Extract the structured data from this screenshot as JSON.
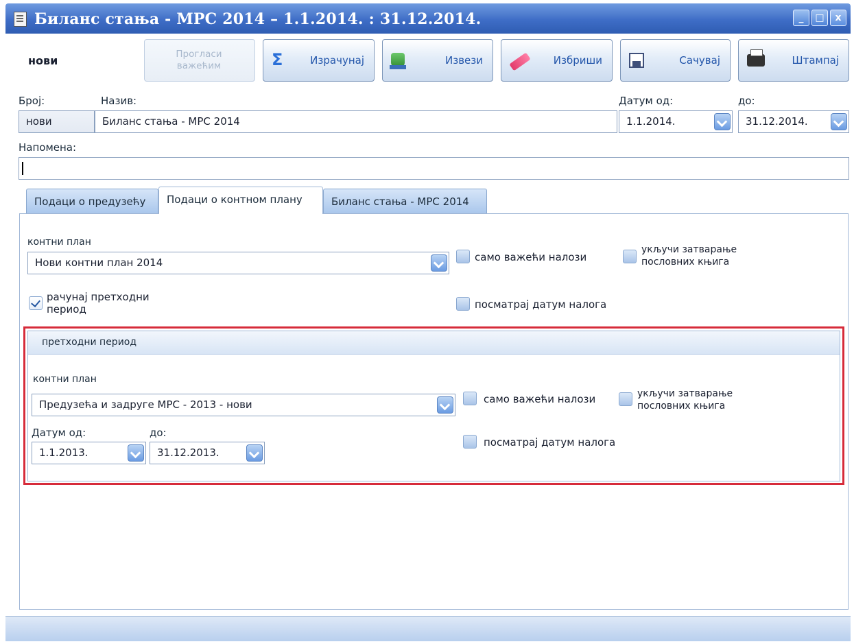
{
  "window": {
    "title": "Биланс стања - МРС 2014 – 1.1.2014. : 31.12.2014.",
    "buttons": {
      "minimize": "_",
      "maximize": "□",
      "close": "x"
    }
  },
  "toolbar": {
    "status": "нови",
    "declare_valid": "Прогласи важећим",
    "calculate": "Израчунај",
    "export": "Извези",
    "delete": "Избриши",
    "save": "Сачувај",
    "print": "Штампај"
  },
  "form": {
    "number_label": "Број:",
    "number_value": "нови",
    "name_label": "Назив:",
    "name_value": "Биланс стања - МРС 2014",
    "date_from_label": "Датум од:",
    "date_from_value": "1.1.2014.",
    "date_to_label": "до:",
    "date_to_value": "31.12.2014.",
    "note_label": "Напомена:",
    "note_value": ""
  },
  "tabs": [
    {
      "label": "Подаци о предузећу"
    },
    {
      "label": "Подаци о контном плану"
    },
    {
      "label": "Биланс стања - МРС 2014"
    }
  ],
  "current": {
    "plan_label": "контни план",
    "plan_value": "Нови контни план 2014",
    "only_valid": "само важећи налози",
    "include_closing_line1": "укључи затварање",
    "include_closing_line2": "пословних књига",
    "calc_prev_line1": "рачунај претходни",
    "calc_prev_line2": "период",
    "observe_date": "посматрај датум налога"
  },
  "previous": {
    "group_title": "претходни период",
    "plan_label": "контни план",
    "plan_value": "Предузећа и задруге МРС - 2013 - нови",
    "date_from_label": "Датум од:",
    "date_from_value": "1.1.2013.",
    "date_to_label": "до:",
    "date_to_value": "31.12.2013.",
    "only_valid": "само важећи налози",
    "include_closing_line1": "укључи затварање",
    "include_closing_line2": "пословних књига",
    "observe_date": "посматрај датум налога"
  },
  "checks": {
    "only_valid": false,
    "include_closing": false,
    "calc_prev": true,
    "observe_date": false,
    "prev_only_valid": false,
    "prev_include_closing": false,
    "prev_observe_date": false
  },
  "colors": {
    "highlight_border": "#d62b3a",
    "title_bar": "#3e6dc6",
    "accent_text": "#2255aa"
  }
}
